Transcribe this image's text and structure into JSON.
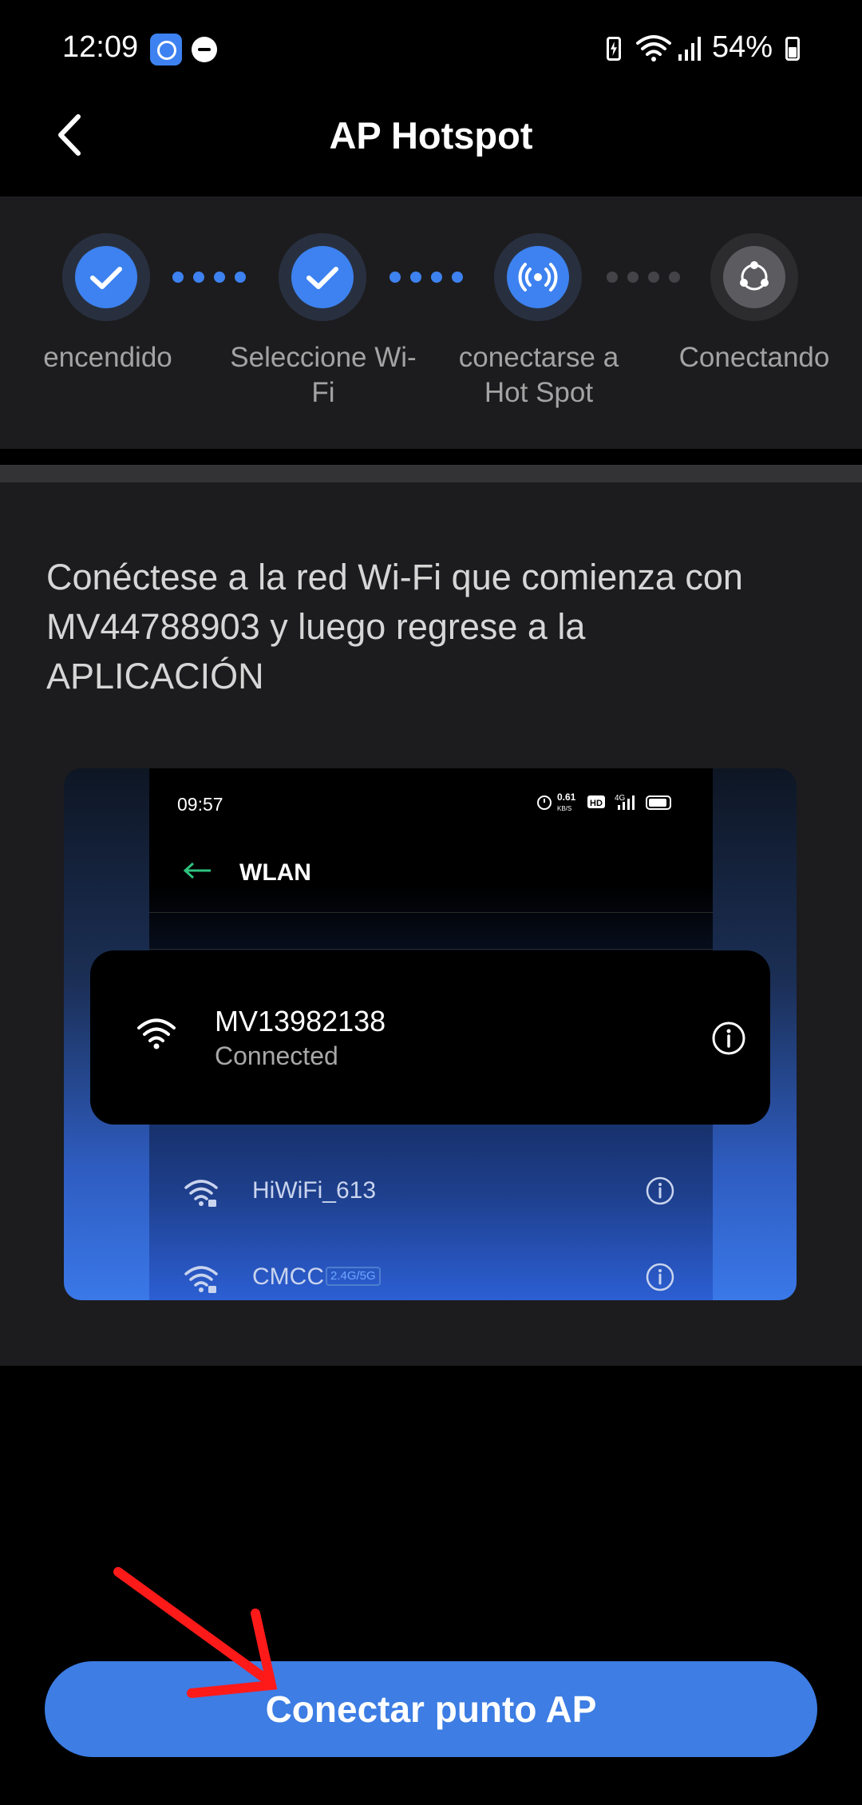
{
  "status_bar": {
    "time": "12:09",
    "battery_percent": "54%",
    "icons": [
      "app-notification-icon",
      "do-not-disturb-icon",
      "battery-saver-icon",
      "wifi-icon",
      "signal-icon",
      "battery-icon"
    ]
  },
  "header": {
    "back_icon": "chevron-left-icon",
    "title": "AP Hotspot"
  },
  "stepper": {
    "steps": [
      {
        "label": "encendido",
        "state": "done",
        "icon": "check-icon"
      },
      {
        "label": "Seleccione Wi-Fi",
        "state": "done",
        "icon": "check-icon"
      },
      {
        "label": "conectarse a Hot Spot",
        "state": "current",
        "icon": "hotspot-icon"
      },
      {
        "label": "Conectando",
        "state": "pending",
        "icon": "connecting-icon"
      }
    ]
  },
  "instruction": "Conéctese a la red Wi-Fi que comienza con MV44788903 y luego regrese a la APLICACIÓN",
  "illustration": {
    "phone_time": "09:57",
    "phone_speed": "0.61",
    "phone_speed_unit": "KB/S",
    "phone_hd": "HD",
    "phone_network": "4G",
    "screen_title": "WLAN",
    "connected_network": {
      "ssid": "MV13982138",
      "status": "Connected"
    },
    "other_networks": [
      {
        "ssid": "HiWiFi_613",
        "badge": ""
      },
      {
        "ssid": "CMCC",
        "badge": "2.4G/5G"
      }
    ]
  },
  "connect_button_label": "Conectar punto AP",
  "colors": {
    "accent": "#3d82f0",
    "background": "#000000",
    "panel": "#1c1c1e",
    "annotation_arrow": "#ff1a1a"
  }
}
